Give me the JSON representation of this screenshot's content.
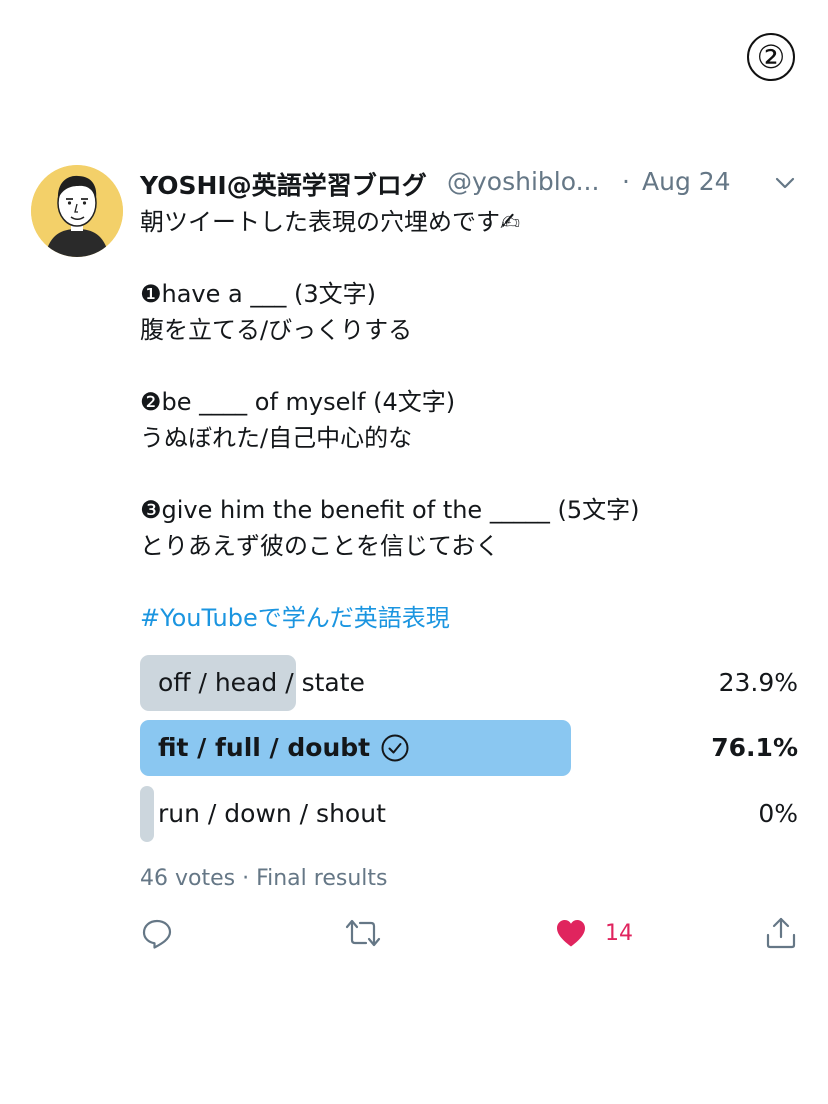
{
  "page_marker": "②",
  "tweet": {
    "display_name": "YOSHI@英語学習ブログ",
    "handle": "@yoshiblo...",
    "separator": "·",
    "date": "Aug 24",
    "lines": [
      "朝ツイートした表現の穴埋めです✍",
      "",
      "❶have a ___ (3文字)",
      "腹を立てる/びっくりする",
      "",
      "❷be ____ of myself (4文字)",
      "うぬぼれた/自己中心的な",
      "",
      "❸give him  the benefit of the _____ (5文字)",
      "とりあえず彼のことを信じておく"
    ],
    "hashtag": "#YouTubeで学んだ英語表現"
  },
  "poll": {
    "options": [
      {
        "label": "off / head / state",
        "percent_text": "23.9%",
        "fraction": 0.239,
        "winner": false
      },
      {
        "label": "fit / full / doubt",
        "percent_text": "76.1%",
        "fraction": 0.761,
        "winner": true
      },
      {
        "label": "run / down / shout",
        "percent_text": "0%",
        "fraction": 0.0,
        "winner": false
      }
    ],
    "meta": "46 votes · Final results"
  },
  "actions": {
    "like_count": "14"
  },
  "colors": {
    "winner_bar": "#8ac7f1",
    "other_bar": "#ccd6dd",
    "link": "#1b95e0",
    "like": "#e0245e",
    "muted": "#657786"
  },
  "icons": {
    "reply": "reply-icon",
    "retweet": "retweet-icon",
    "like": "heart-icon",
    "share": "share-icon",
    "menu": "chevron-down-icon",
    "check": "check-circle-icon"
  }
}
